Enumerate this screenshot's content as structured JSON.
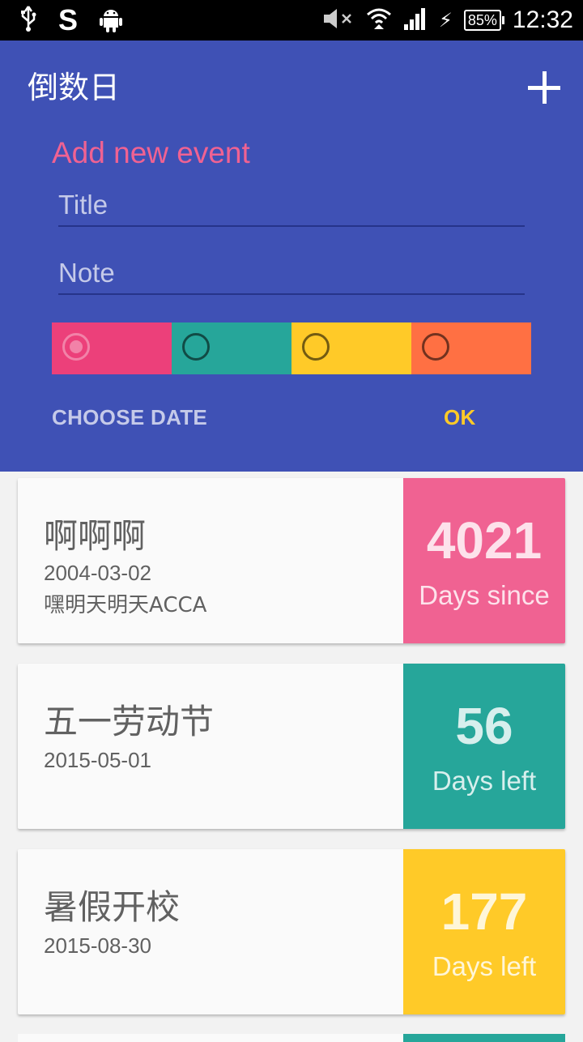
{
  "status_bar": {
    "icons": [
      "usb-icon",
      "s-app-icon",
      "android-icon",
      "mute-icon",
      "wifi-icon",
      "signal-icon",
      "charging-icon",
      "battery-icon"
    ],
    "s_label": "S",
    "battery": "85%",
    "time": "12:32"
  },
  "header": {
    "app_title": "倒数日",
    "add_icon": "plus-icon",
    "form": {
      "title": "Add new event",
      "title_placeholder": "Title",
      "note_placeholder": "Note",
      "colors": [
        "#ec407a",
        "#26a69a",
        "#ffca28",
        "#ff7043"
      ],
      "selected_color_index": 0,
      "choose_date_label": "CHOOSE DATE",
      "ok_label": "OK"
    }
  },
  "events": [
    {
      "name": "啊啊啊",
      "date": "2004-03-02",
      "note": "嘿明天明天ACCA",
      "count": "4021",
      "label": "Days since",
      "color": "#f06292"
    },
    {
      "name": "五一劳动节",
      "date": "2015-05-01",
      "note": "",
      "count": "56",
      "label": "Days left",
      "color": "#26a69a"
    },
    {
      "name": "暑假开校",
      "date": "2015-08-30",
      "note": "",
      "count": "177",
      "label": "Days left",
      "color": "#ffca28"
    }
  ]
}
